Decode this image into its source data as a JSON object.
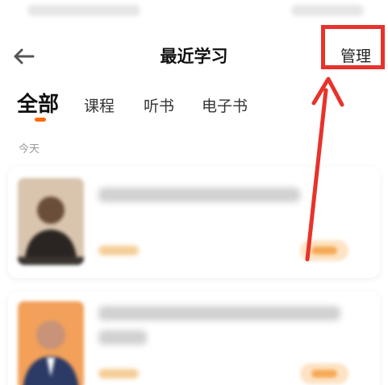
{
  "header": {
    "title": "最近学习",
    "manage_label": "管理"
  },
  "tabs": [
    {
      "label": "全部",
      "active": true
    },
    {
      "label": "课程",
      "active": false
    },
    {
      "label": "听书",
      "active": false
    },
    {
      "label": "电子书",
      "active": false
    }
  ],
  "section": {
    "date_label": "今天"
  },
  "colors": {
    "accent": "#ff6a00",
    "annotation": "#e8322c"
  },
  "icons": {
    "back": "arrow-left-icon"
  }
}
